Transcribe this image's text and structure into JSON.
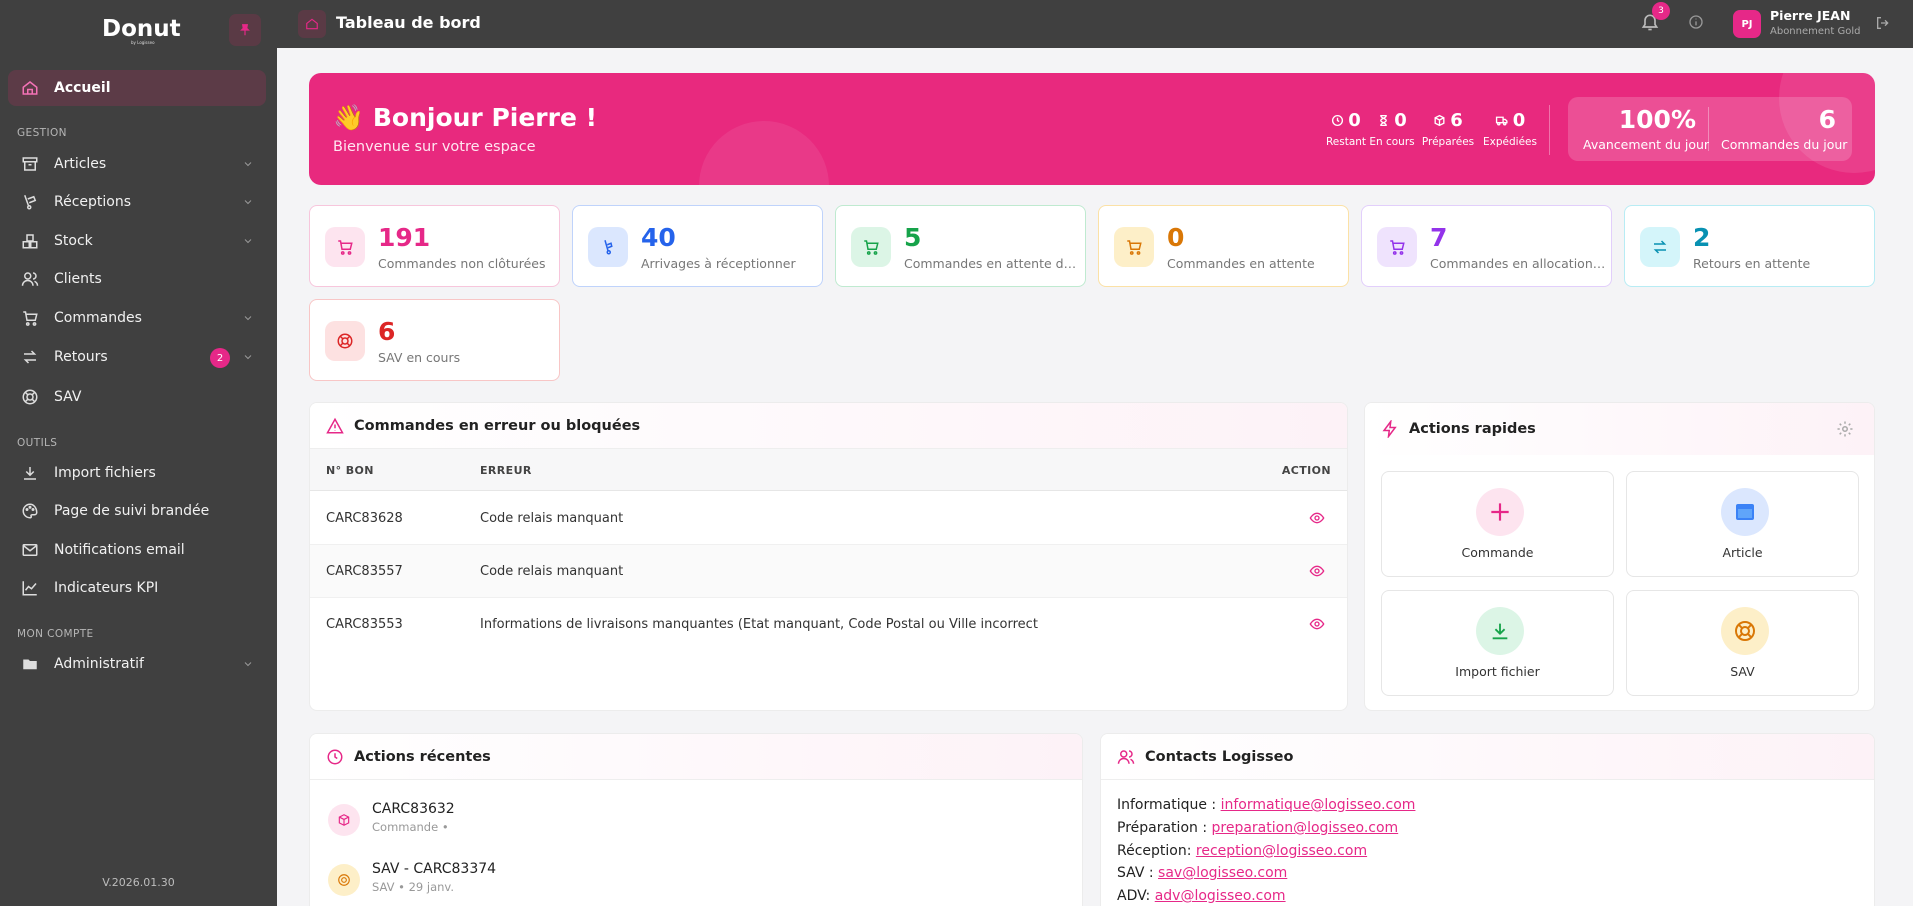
{
  "app": {
    "brand": "Donut",
    "brand_sub": "by Logisseo",
    "version": "V.2026.01.30"
  },
  "sidebar": {
    "items": [
      {
        "label": "Accueil"
      },
      {
        "label": "Articles"
      },
      {
        "label": "Réceptions"
      },
      {
        "label": "Stock"
      },
      {
        "label": "Clients"
      },
      {
        "label": "Commandes"
      },
      {
        "label": "Retours",
        "badge": "2"
      },
      {
        "label": "SAV"
      },
      {
        "label": "Import fichiers"
      },
      {
        "label": "Page de suivi brandée"
      },
      {
        "label": "Notifications email"
      },
      {
        "label": "Indicateurs KPI"
      },
      {
        "label": "Administratif"
      }
    ],
    "sections": {
      "gestion": "GESTION",
      "outils": "OUTILS",
      "compte": "MON COMPTE"
    }
  },
  "header": {
    "title": "Tableau de bord",
    "notifications": "3",
    "user_initials": "PJ",
    "user_name": "Pierre JEAN",
    "user_plan": "Abonnement Gold"
  },
  "banner": {
    "emoji": "👋",
    "greeting": "Bonjour Pierre !",
    "welcome": "Bienvenue sur votre espace",
    "stats": [
      {
        "value": "0",
        "label": "Restant"
      },
      {
        "value": "0",
        "label": "En cours"
      },
      {
        "value": "6",
        "label": "Préparées"
      },
      {
        "value": "0",
        "label": "Expédiées"
      }
    ],
    "progress_value": "100%",
    "progress_label": "Avancement du jour",
    "orders_value": "6",
    "orders_label": "Commandes du jour"
  },
  "cards": [
    {
      "value": "191",
      "label": "Commandes non clôturées",
      "color": "#e62888"
    },
    {
      "value": "40",
      "label": "Arrivages à réceptionner",
      "color": "#2563eb"
    },
    {
      "value": "5",
      "label": "Commandes en attente de …",
      "color": "#16a34a"
    },
    {
      "value": "0",
      "label": "Commandes en attente",
      "color": "#d97706"
    },
    {
      "value": "7",
      "label": "Commandes en allocation …",
      "color": "#9333ea"
    },
    {
      "value": "2",
      "label": "Retours en attente",
      "color": "#0891b2"
    },
    {
      "value": "6",
      "label": "SAV en cours",
      "color": "#dc2626"
    }
  ],
  "errors": {
    "title": "Commandes en erreur ou bloquées",
    "columns": [
      "N° BON",
      "ERREUR",
      "ACTION"
    ],
    "rows": [
      {
        "bon": "CARC83628",
        "erreur": "Code relais manquant"
      },
      {
        "bon": "CARC83557",
        "erreur": "Code relais manquant"
      },
      {
        "bon": "CARC83553",
        "erreur": "Informations de livraisons manquantes (Etat manquant, Code Postal ou Ville incorrect"
      }
    ]
  },
  "quick_actions": {
    "title": "Actions rapides",
    "items": [
      {
        "label": "Commande"
      },
      {
        "label": "Article"
      },
      {
        "label": "Import fichier"
      },
      {
        "label": "SAV"
      }
    ]
  },
  "recent": {
    "title": "Actions récentes",
    "items": [
      {
        "title": "CARC83632",
        "sub": "Commande •"
      },
      {
        "title": "SAV - CARC83374",
        "sub": "SAV • 29 janv."
      }
    ]
  },
  "contacts": {
    "title": "Contacts Logisseo",
    "items": [
      {
        "label": "Informatique :",
        "email": "informatique@logisseo.com"
      },
      {
        "label": "Préparation :",
        "email": "preparation@logisseo.com"
      },
      {
        "label": "Réception:",
        "email": "reception@logisseo.com"
      },
      {
        "label": "SAV :",
        "email": "sav@logisseo.com"
      },
      {
        "label": "ADV:",
        "email": "adv@logisseo.com"
      }
    ]
  }
}
